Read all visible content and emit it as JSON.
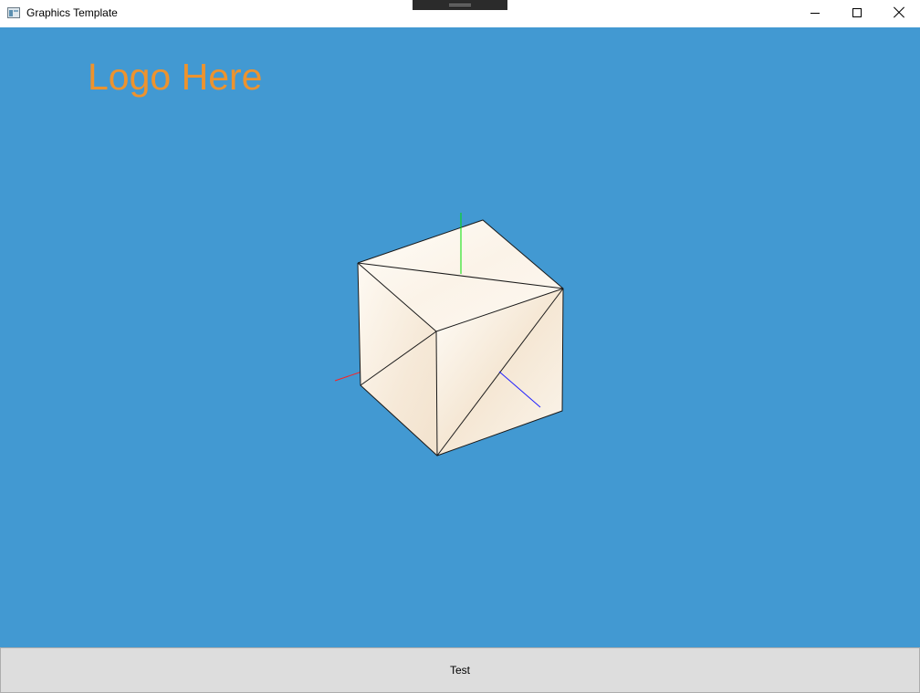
{
  "window": {
    "title": "Graphics Template"
  },
  "viewport": {
    "logo_text": "Logo Here",
    "background_color": "#4299d2",
    "logo_color": "#ed932e"
  },
  "scene": {
    "object": "cube",
    "axes": [
      {
        "axis": "x",
        "color": "#ff2020"
      },
      {
        "axis": "y",
        "color": "#00e000"
      },
      {
        "axis": "z",
        "color": "#2020ff"
      }
    ]
  },
  "footer": {
    "button_label": "Test"
  },
  "icons": {
    "app": "app-window-icon",
    "minimize": "minimize-icon",
    "maximize": "maximize-icon",
    "close": "close-icon"
  }
}
